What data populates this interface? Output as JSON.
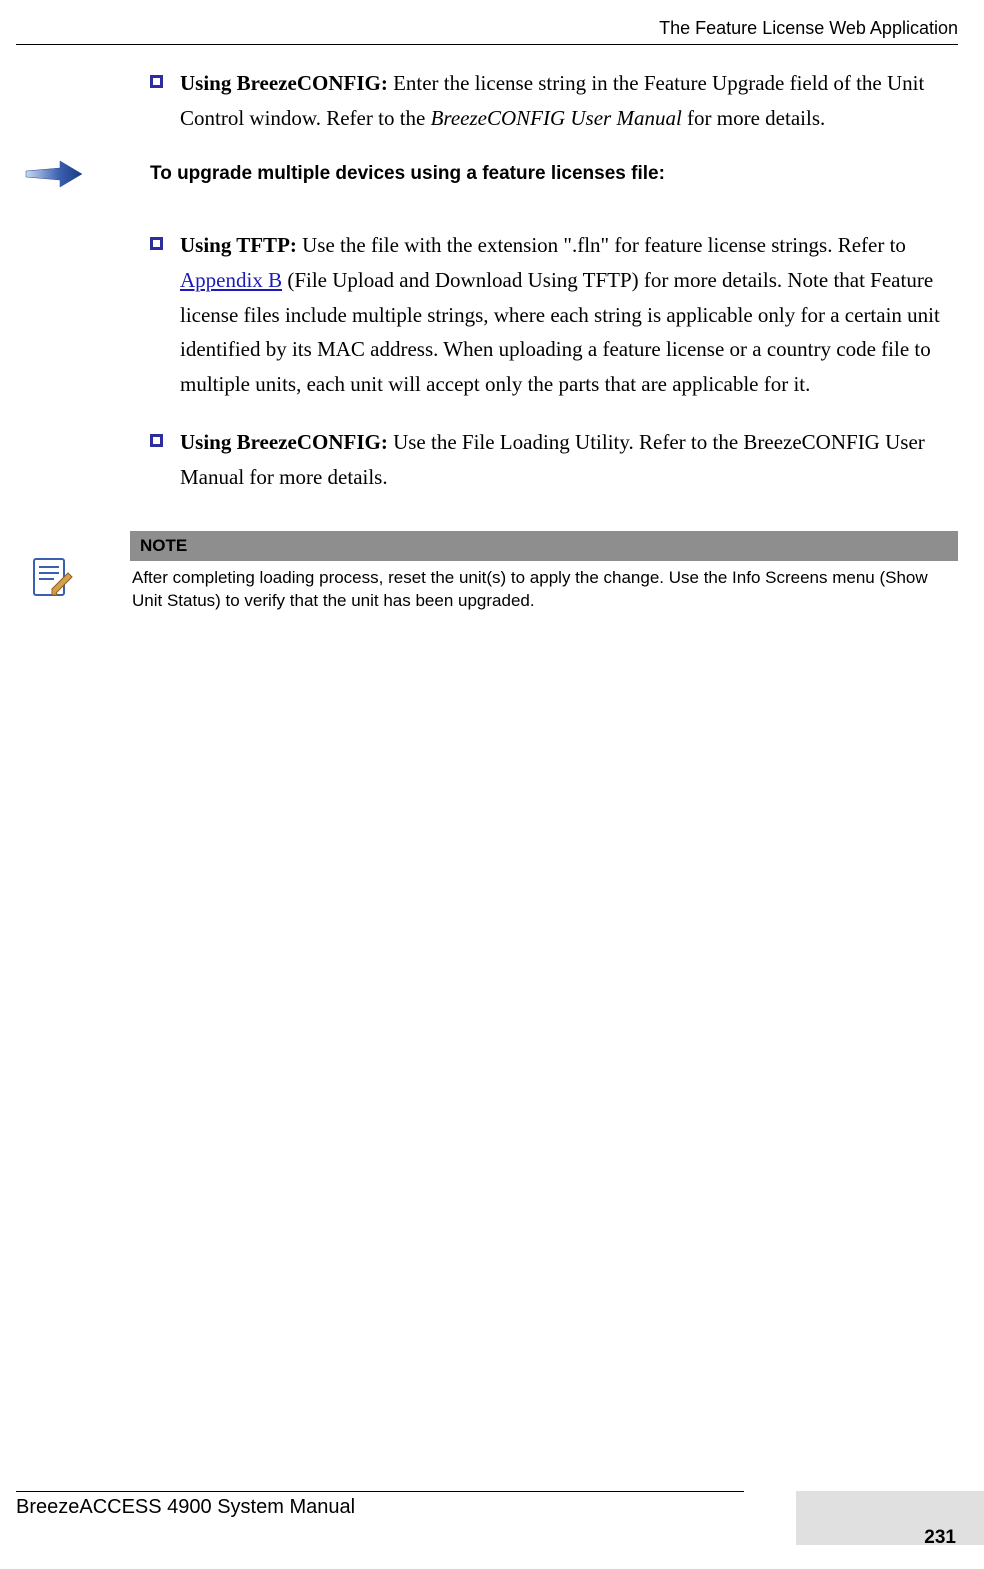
{
  "header": {
    "title": "The Feature License Web Application"
  },
  "bullets": {
    "b1": {
      "lead": "Using BreezeCONFIG:",
      "text_a": " Enter the license string in the Feature Upgrade field of the Unit Control window. Refer to the ",
      "italic": "BreezeCONFIG User Manual",
      "text_b": " for more details."
    },
    "b2": {
      "lead": "Using TFTP:",
      "text_a": "  Use the file with the extension \".fln\" for feature license strings. Refer to ",
      "link": "Appendix B",
      "text_b": " (File Upload and Download Using TFTP) for more details. Note that Feature license files include multiple strings, where each string is applicable only for a certain unit identified by its MAC address. When uploading a feature license or a country code file to multiple units, each unit will accept only the parts that are applicable for it."
    },
    "b3": {
      "lead": "Using BreezeCONFIG:",
      "text": " Use the File Loading Utility. Refer to the BreezeCONFIG User Manual for more details."
    }
  },
  "procedure": {
    "text": "To upgrade multiple devices using a feature licenses file:"
  },
  "note": {
    "head": "NOTE",
    "text": "After completing loading process, reset the unit(s) to apply the change. Use the Info Screens menu (Show Unit Status) to verify that the unit has been upgraded."
  },
  "footer": {
    "manual": "BreezeACCESS 4900 System Manual",
    "page": "231"
  }
}
